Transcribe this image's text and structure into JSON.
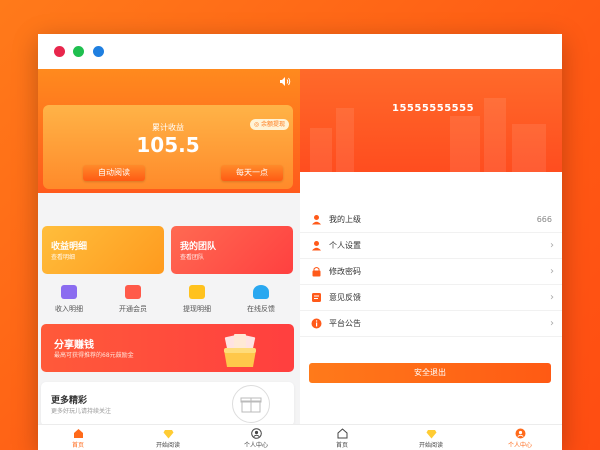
{
  "window": {
    "controls": [
      "close",
      "minimize",
      "maximize"
    ]
  },
  "left": {
    "speaker_icon": "speaker-icon",
    "earnings": {
      "label": "累计收益",
      "value": "105.5",
      "tag": "余额提现",
      "auto_read_button": "自动阅读",
      "daily_button": "每天一点"
    },
    "cards": {
      "income": {
        "title": "收益明细",
        "subtitle": "查看明细"
      },
      "team": {
        "title": "我的团队",
        "subtitle": "查看团队"
      }
    },
    "quick_links": [
      {
        "label": "收入明细",
        "icon": "wallet-icon",
        "color": "#8b6cf0"
      },
      {
        "label": "开通会员",
        "icon": "gift-icon",
        "color": "#ff5a4a"
      },
      {
        "label": "提现明细",
        "icon": "question-icon",
        "color": "#ffc21e"
      },
      {
        "label": "在线反馈",
        "icon": "user-icon",
        "color": "#2aa8f0"
      }
    ],
    "share": {
      "title": "分享赚钱",
      "subtitle": "最高可获得推荐的68元鼓励金"
    },
    "more": {
      "title": "更多精彩",
      "subtitle": "更多好玩儿请持续关注"
    },
    "tabs": [
      {
        "label": "首页",
        "icon": "home-icon",
        "active": true
      },
      {
        "label": "开始阅读",
        "icon": "diamond-icon",
        "active": false
      },
      {
        "label": "个人中心",
        "icon": "profile-icon",
        "active": false
      }
    ]
  },
  "right": {
    "phone": "15555555555",
    "menu": [
      {
        "label": "我的上级",
        "value": "666",
        "icon": "user-icon",
        "chevron": false
      },
      {
        "label": "个人设置",
        "value": "",
        "icon": "user-icon",
        "chevron": true
      },
      {
        "label": "修改密码",
        "value": "",
        "icon": "lock-icon",
        "chevron": true
      },
      {
        "label": "意见反馈",
        "value": "",
        "icon": "feedback-icon",
        "chevron": true
      },
      {
        "label": "平台公告",
        "value": "",
        "icon": "info-icon",
        "chevron": true
      }
    ],
    "logout": "安全退出",
    "tabs": [
      {
        "label": "首页",
        "icon": "home-icon",
        "active": false
      },
      {
        "label": "开始阅读",
        "icon": "diamond-icon",
        "active": false
      },
      {
        "label": "个人中心",
        "icon": "profile-icon",
        "active": true
      }
    ]
  },
  "colors": {
    "accent": "#ff6a1a",
    "accent_dark": "#ff4d1f",
    "text": "#333333"
  }
}
